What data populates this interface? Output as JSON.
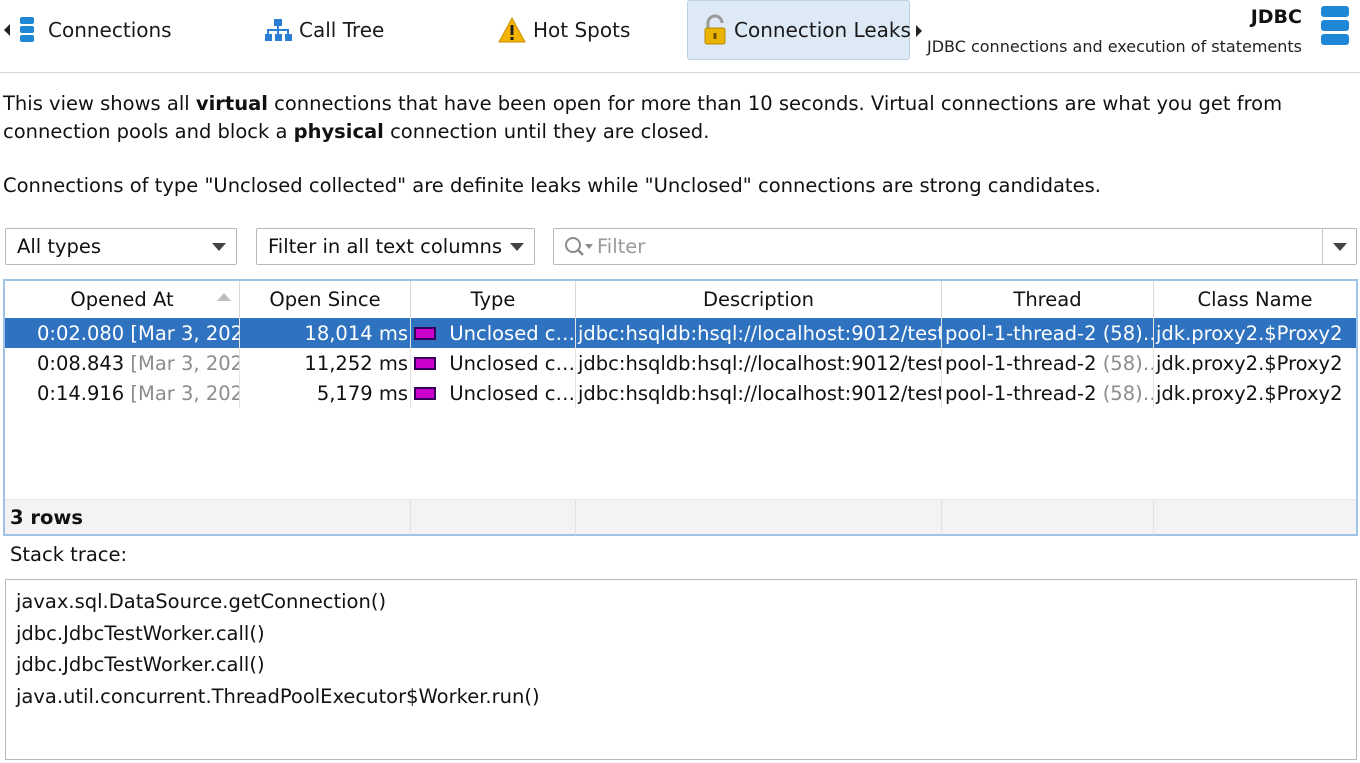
{
  "tabs": [
    {
      "label": "Connections",
      "icon": "database-icon",
      "active": false
    },
    {
      "label": "Call Tree",
      "icon": "call-tree-icon",
      "active": false
    },
    {
      "label": "Hot Spots",
      "icon": "warning-icon",
      "active": false
    },
    {
      "label": "Connection Leaks",
      "icon": "open-lock-icon",
      "active": true
    }
  ],
  "header": {
    "title": "JDBC",
    "subtitle": "JDBC connections and execution of statements"
  },
  "description": {
    "p1_a": "This view shows all ",
    "p1_b": "virtual",
    "p1_c": " connections that have been open for more than 10 seconds. Virtual connections are what you get from connection pools and block a ",
    "p1_d": "physical",
    "p1_e": " connection until they are closed.",
    "p2": "Connections of type \"Unclosed collected\" are definite leaks while \"Unclosed\" connections are strong candidates."
  },
  "filters": {
    "type_select": "All types",
    "column_select": "Filter in all text columns",
    "search_placeholder": "Filter"
  },
  "table": {
    "columns": [
      "Opened At",
      "Open Since",
      "Type",
      "Description",
      "Thread",
      "Class Name"
    ],
    "rows": [
      {
        "opened_time": "0:02.080",
        "opened_date": "[Mar 3, 202…",
        "open_since": "18,014 ms",
        "type": "Unclosed c…",
        "description": "jdbc:hsqldb:hsql://localhost:9012/test",
        "thread": "pool-1-thread-2",
        "thread_id": "(58)…",
        "class_name": "jdk.proxy2.$Proxy2"
      },
      {
        "opened_time": "0:08.843",
        "opened_date": "[Mar 3, 202…",
        "open_since": "11,252 ms",
        "type": "Unclosed c…",
        "description": "jdbc:hsqldb:hsql://localhost:9012/test",
        "thread": "pool-1-thread-2",
        "thread_id": "(58)…",
        "class_name": "jdk.proxy2.$Proxy2"
      },
      {
        "opened_time": "0:14.916",
        "opened_date": "[Mar 3, 202…",
        "open_since": "5,179 ms",
        "type": "Unclosed c…",
        "description": "jdbc:hsqldb:hsql://localhost:9012/test",
        "thread": "pool-1-thread-2",
        "thread_id": "(58)…",
        "class_name": "jdk.proxy2.$Proxy2"
      }
    ],
    "row_count": "3 rows",
    "type_color": "#cc00cc",
    "selection_color": "#2f73c0"
  },
  "stack_trace": {
    "label": "Stack trace:",
    "lines": [
      "javax.sql.DataSource.getConnection()",
      "jdbc.JdbcTestWorker.call()",
      "jdbc.JdbcTestWorker.call()",
      "java.util.concurrent.ThreadPoolExecutor$Worker.run()"
    ]
  }
}
